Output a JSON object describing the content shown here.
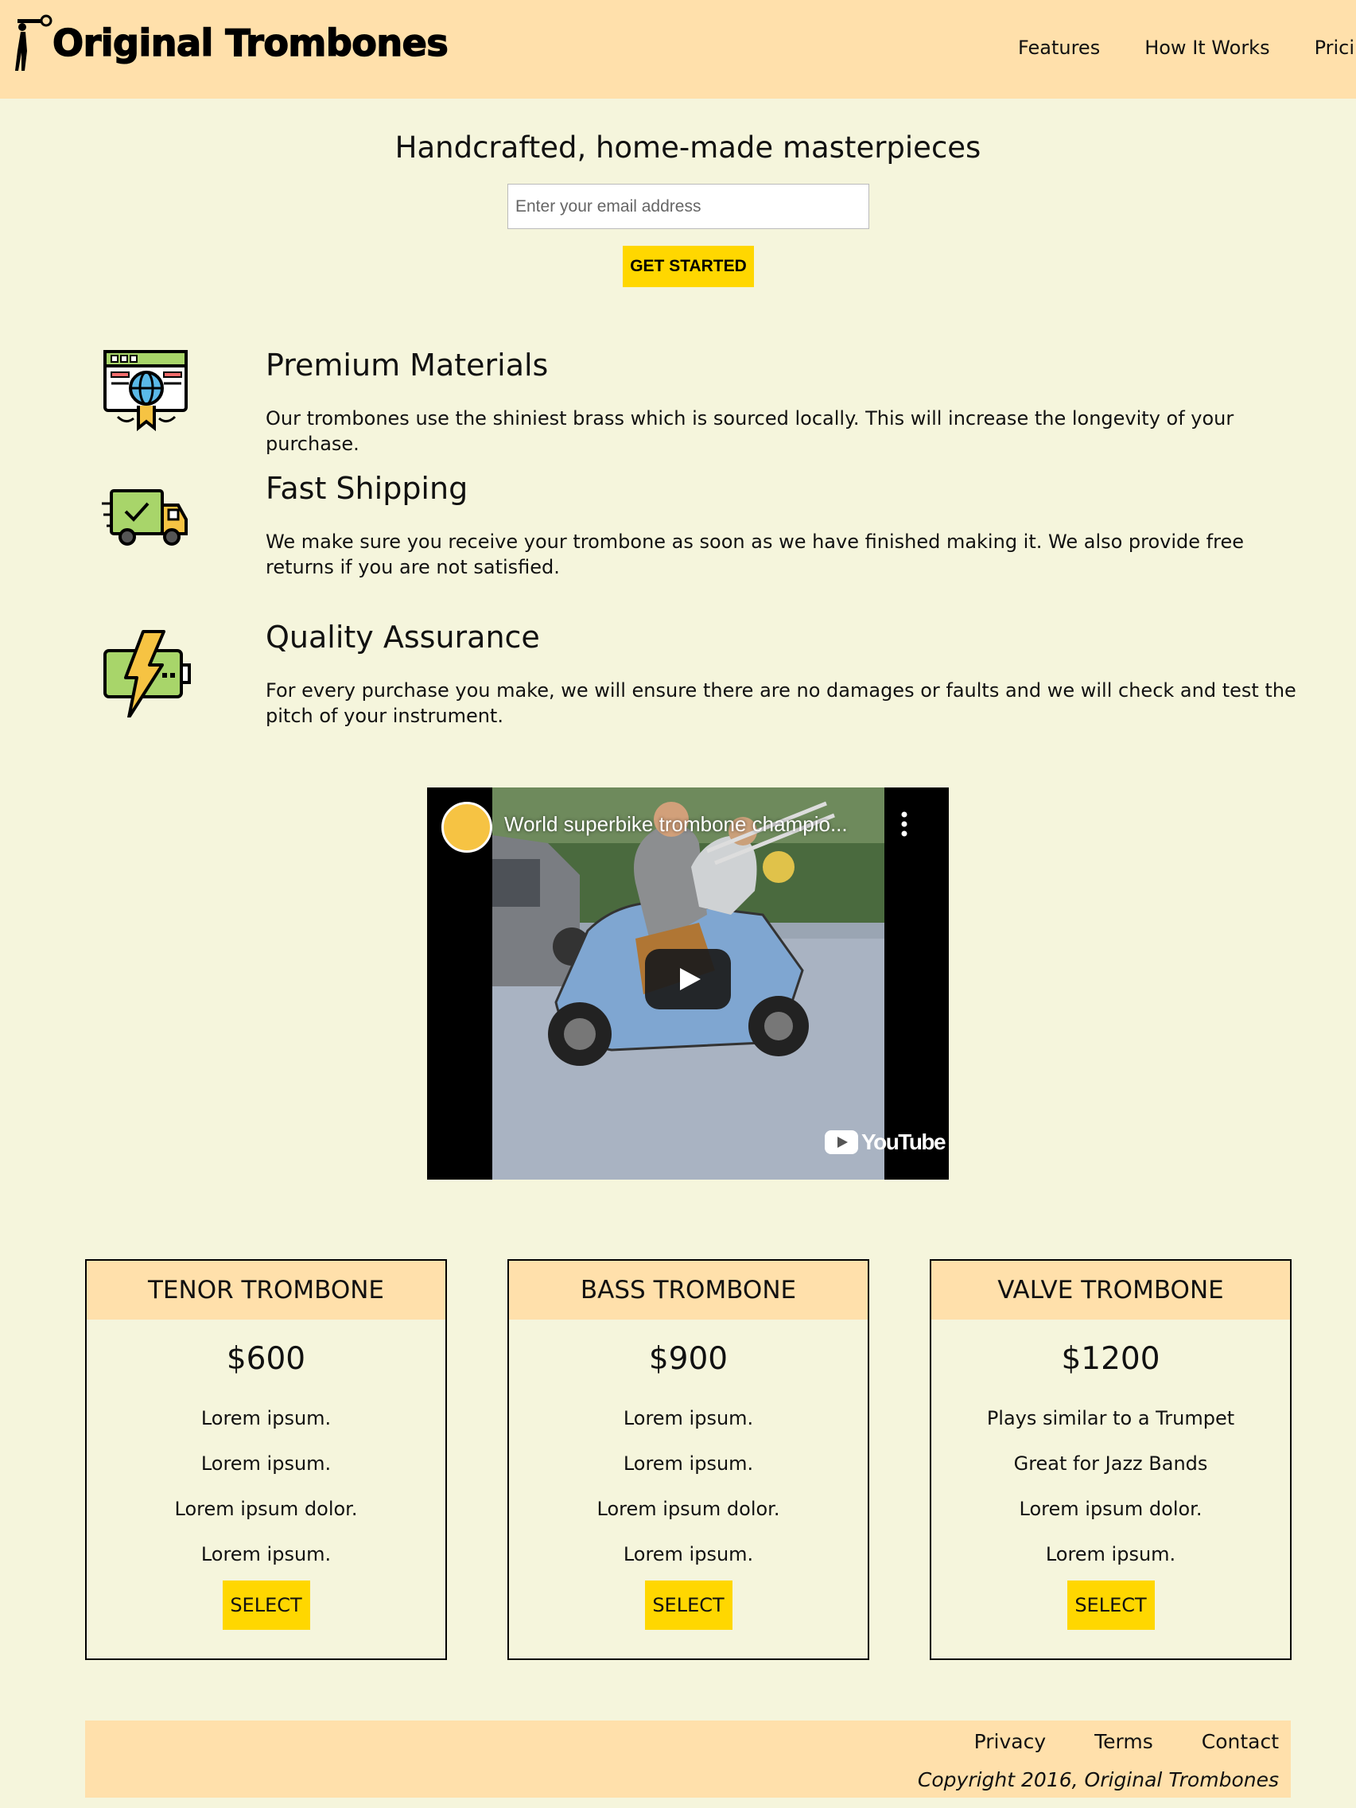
{
  "header": {
    "logo_text": "Original Trombones",
    "nav": [
      "Features",
      "How It Works",
      "Pricing"
    ]
  },
  "hero": {
    "title": "Handcrafted, home-made masterpieces",
    "email_placeholder": "Enter your email address",
    "cta_label": "GET STARTED"
  },
  "features": [
    {
      "icon": "certificate-globe-icon",
      "title": "Premium Materials",
      "text": "Our trombones use the shiniest brass which is sourced locally. This will increase the longevity of your purchase."
    },
    {
      "icon": "delivery-truck-icon",
      "title": "Fast Shipping",
      "text": "We make sure you receive your trombone as soon as we have finished making it. We also provide free returns if you are not satisfied."
    },
    {
      "icon": "battery-lightning-icon",
      "title": "Quality Assurance",
      "text": "For every purchase you make, we will ensure there are no damages or faults and we will check and test the pitch of your instrument."
    }
  ],
  "video": {
    "title": "World superbike trombone champio...",
    "brand": "YouTube"
  },
  "pricing": [
    {
      "name": "TENOR TROMBONE",
      "price": "$600",
      "features": [
        "Lorem ipsum.",
        "Lorem ipsum.",
        "Lorem ipsum dolor.",
        "Lorem ipsum."
      ],
      "button": "SELECT"
    },
    {
      "name": "BASS TROMBONE",
      "price": "$900",
      "features": [
        "Lorem ipsum.",
        "Lorem ipsum.",
        "Lorem ipsum dolor.",
        "Lorem ipsum."
      ],
      "button": "SELECT"
    },
    {
      "name": "VALVE TROMBONE",
      "price": "$1200",
      "features": [
        "Plays similar to a Trumpet",
        "Great for Jazz Bands",
        "Lorem ipsum dolor.",
        "Lorem ipsum."
      ],
      "button": "SELECT"
    }
  ],
  "footer": {
    "links": [
      "Privacy",
      "Terms",
      "Contact"
    ],
    "copyright": "Copyright 2016, Original Trombones"
  },
  "colors": {
    "page_background": "#f5f5dc",
    "header_background": "#ffe0ab",
    "button_yellow": "#ffd700"
  }
}
